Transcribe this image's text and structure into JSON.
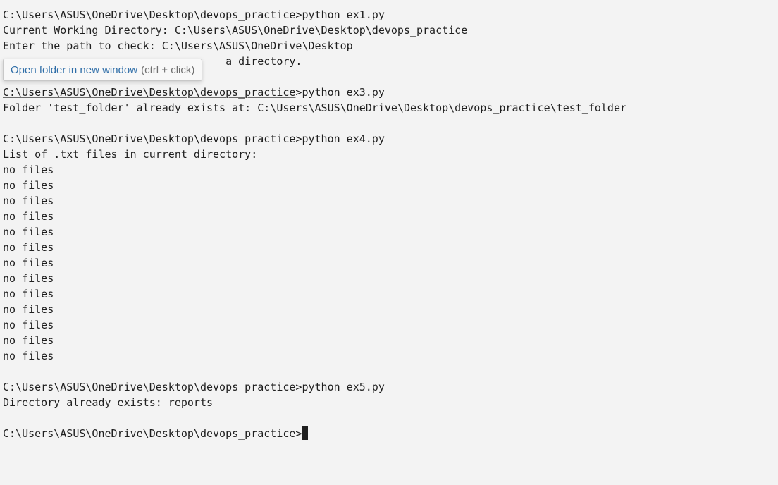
{
  "terminal": {
    "lines": [
      "C:\\Users\\ASUS\\OneDrive\\Desktop\\devops_practice>python ex1.py",
      "Current Working Directory: C:\\Users\\ASUS\\OneDrive\\Desktop\\devops_practice",
      "Enter the path to check: C:\\Users\\ASUS\\OneDrive\\Desktop",
      "                                   a directory.",
      "",
      "C:\\Users\\ASUS\\OneDrive\\Desktop\\devops_practice>python ex3.py",
      "Folder 'test_folder' already exists at: C:\\Users\\ASUS\\OneDrive\\Desktop\\devops_practice\\test_folder",
      "",
      "C:\\Users\\ASUS\\OneDrive\\Desktop\\devops_practice>python ex4.py",
      "List of .txt files in current directory:",
      "no files",
      "no files",
      "no files",
      "no files",
      "no files",
      "no files",
      "no files",
      "no files",
      "no files",
      "no files",
      "no files",
      "no files",
      "no files",
      "",
      "C:\\Users\\ASUS\\OneDrive\\Desktop\\devops_practice>python ex5.py",
      "Directory already exists: reports",
      "",
      "C:\\Users\\ASUS\\OneDrive\\Desktop\\devops_practice>"
    ],
    "linked_path": "C:\\Users\\ASUS\\OneDrive\\Desktop\\devops_practice",
    "linked_command": ">python ex3.py"
  },
  "tooltip": {
    "link_label": "Open folder in new window",
    "hint": "(ctrl + click)"
  }
}
